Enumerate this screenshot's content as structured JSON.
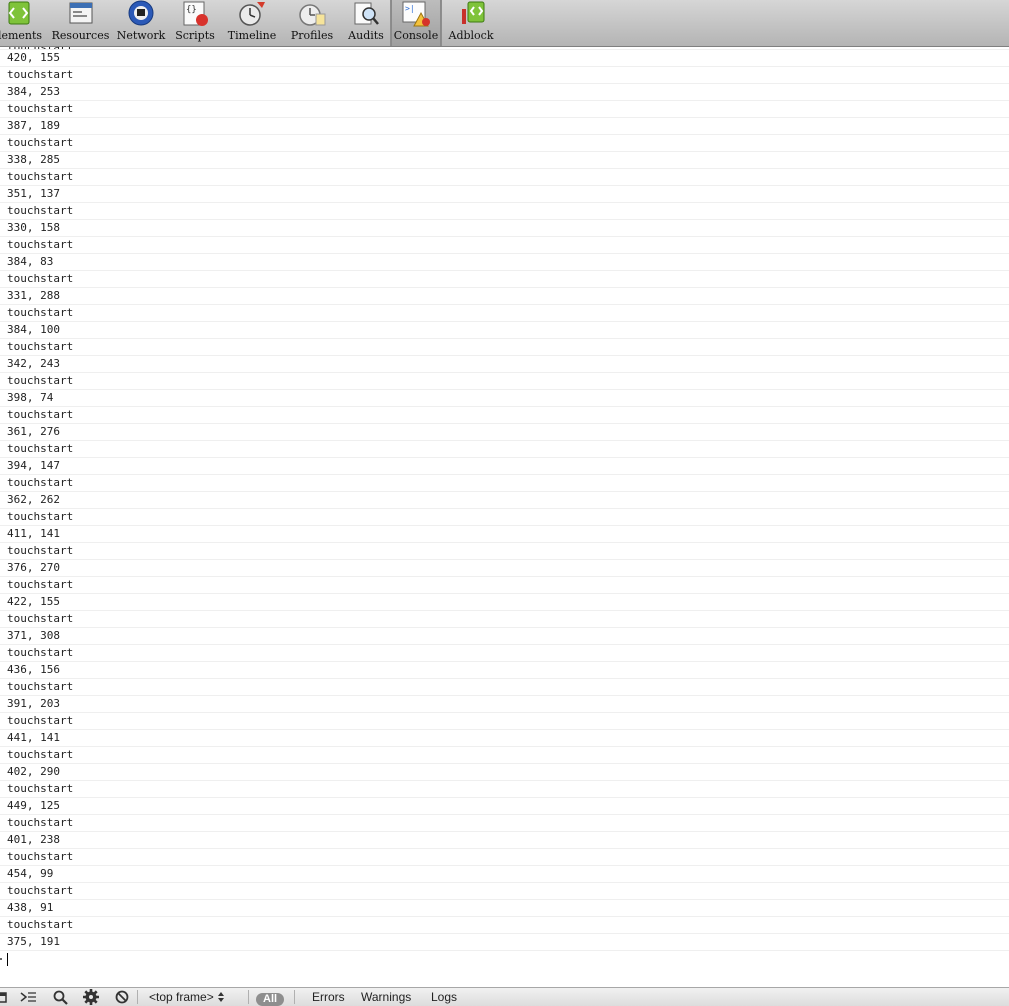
{
  "toolbar": {
    "tabs": [
      {
        "label": "Elements",
        "icon": "elements-icon"
      },
      {
        "label": "Resources",
        "icon": "resources-icon"
      },
      {
        "label": "Network",
        "icon": "network-icon"
      },
      {
        "label": "Scripts",
        "icon": "scripts-icon"
      },
      {
        "label": "Timeline",
        "icon": "timeline-icon"
      },
      {
        "label": "Profiles",
        "icon": "profiles-icon"
      },
      {
        "label": "Audits",
        "icon": "audits-icon"
      },
      {
        "label": "Console",
        "icon": "console-icon",
        "selected": true
      },
      {
        "label": "Adblock",
        "icon": "adblock-icon"
      }
    ]
  },
  "console": {
    "messages": [
      "touchstart",
      "420, 155",
      "touchstart",
      "384, 253",
      "touchstart",
      "387, 189",
      "touchstart",
      "338, 285",
      "touchstart",
      "351, 137",
      "touchstart",
      "330, 158",
      "touchstart",
      "384, 83",
      "touchstart",
      "331, 288",
      "touchstart",
      "384, 100",
      "touchstart",
      "342, 243",
      "touchstart",
      "398, 74",
      "touchstart",
      "361, 276",
      "touchstart",
      "394, 147",
      "touchstart",
      "362, 262",
      "touchstart",
      "411, 141",
      "touchstart",
      "376, 270",
      "touchstart",
      "422, 155",
      "touchstart",
      "371, 308",
      "touchstart",
      "436, 156",
      "touchstart",
      "391, 203",
      "touchstart",
      "441, 141",
      "touchstart",
      "402, 290",
      "touchstart",
      "449, 125",
      "touchstart",
      "401, 238",
      "touchstart",
      "454, 99",
      "touchstart",
      "438, 91",
      "touchstart",
      "375, 191"
    ]
  },
  "statusbar": {
    "frame_select": "<top frame>",
    "filter_all": "All",
    "filter_errors": "Errors",
    "filter_warnings": "Warnings",
    "filter_logs": "Logs"
  }
}
